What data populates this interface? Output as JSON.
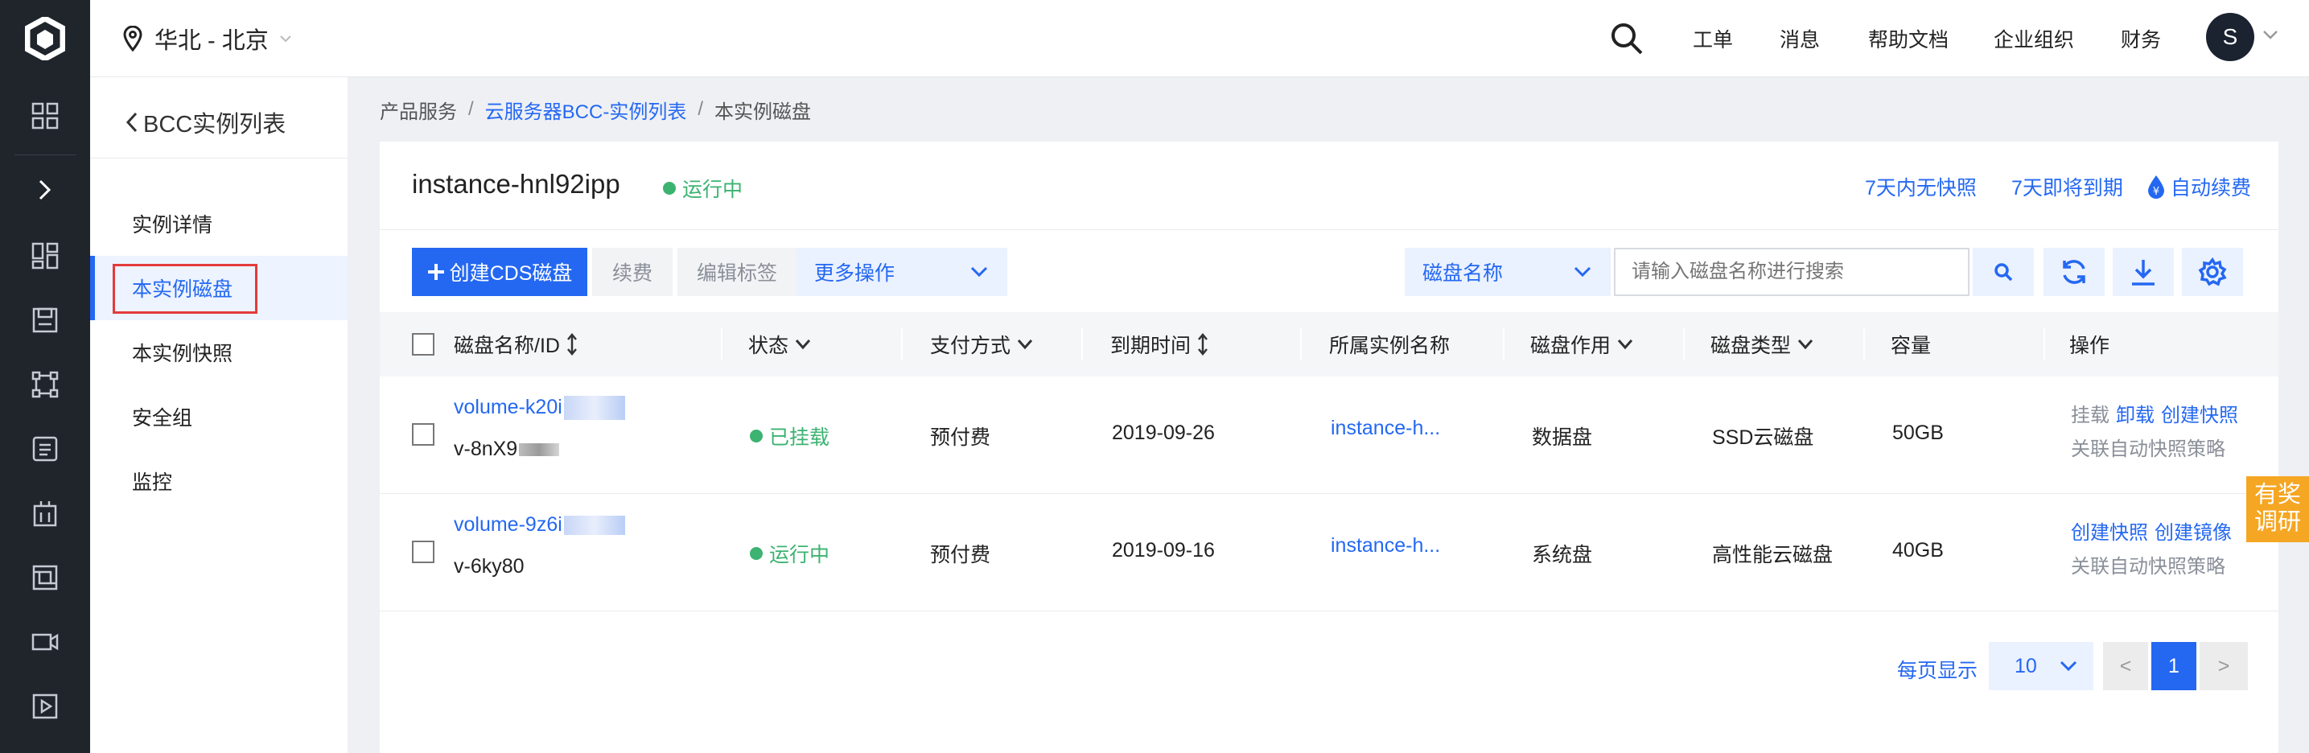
{
  "topbar": {
    "region": "华北 - 北京",
    "nav": [
      "工单",
      "消息",
      "帮助文档",
      "企业组织",
      "财务"
    ],
    "avatar_letter": "S"
  },
  "subnav": {
    "back_label": "BCC实例列表",
    "items": [
      "实例详情",
      "本实例磁盘",
      "本实例快照",
      "安全组",
      "监控"
    ],
    "active_index": 1
  },
  "breadcrumb": {
    "items": [
      "产品服务",
      "云服务器BCC-实例列表",
      "本实例磁盘"
    ]
  },
  "instance": {
    "name": "instance-hnl92ipp",
    "status": "运行中",
    "links": [
      "7天内无快照",
      "7天即将到期",
      "自动续费"
    ]
  },
  "toolbar": {
    "create_label": "创建CDS磁盘",
    "renew_label": "续费",
    "edit_tag_label": "编辑标签",
    "more_label": "更多操作",
    "filter_label": "磁盘名称",
    "search_placeholder": "请输入磁盘名称进行搜索"
  },
  "table": {
    "columns": [
      "磁盘名称/ID",
      "状态",
      "支付方式",
      "到期时间",
      "所属实例名称",
      "磁盘作用",
      "磁盘类型",
      "容量",
      "操作"
    ],
    "rows": [
      {
        "name": "volume-k20i",
        "id": "v-8nX9",
        "status": "已挂载",
        "payment": "预付费",
        "expiry": "2019-09-26",
        "instance": "instance-h...",
        "role": "数据盘",
        "type": "SSD云磁盘",
        "capacity": "50GB",
        "actions": [
          "挂载",
          "卸载",
          "创建快照"
        ],
        "policy": "关联自动快照策略"
      },
      {
        "name": "volume-9z6i",
        "id": "v-6ky80",
        "status": "运行中",
        "payment": "预付费",
        "expiry": "2019-09-16",
        "instance": "instance-h...",
        "role": "系统盘",
        "type": "高性能云磁盘",
        "capacity": "40GB",
        "actions": [
          "创建快照",
          "创建镜像"
        ],
        "policy": "关联自动快照策略"
      }
    ]
  },
  "pagination": {
    "label": "每页显示",
    "page_size": "10",
    "prev": "<",
    "current": "1",
    "next": ">"
  },
  "survey_tab": [
    "有奖",
    "调研"
  ],
  "colors": {
    "accent": "#2468f2",
    "success": "#3cb371",
    "rail_bg": "#20252c",
    "highlight": "#e33b3b",
    "survey": "#f5a623"
  },
  "icons": {
    "rail": [
      "logo-icon",
      "grid-icon",
      "chevron-right-icon",
      "dashboard-icon",
      "save-icon",
      "network-icon",
      "database-icon",
      "building-icon",
      "frame-icon",
      "video-icon",
      "play-icon"
    ]
  }
}
